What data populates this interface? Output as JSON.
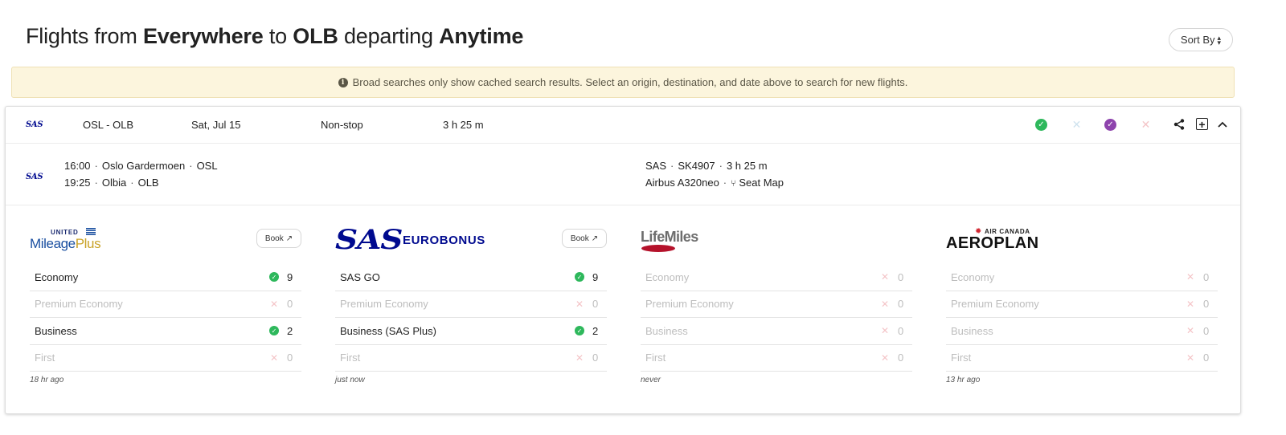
{
  "header": {
    "t1": "Flights from ",
    "origin": "Everywhere",
    "t2": " to ",
    "destination": "OLB",
    "t3": " departing ",
    "when": "Anytime",
    "sort_label": "Sort By"
  },
  "notice": "Broad searches only show cached search results. Select an origin, destination, and date above to search for new flights.",
  "flight": {
    "airline_logo": "SAS",
    "route": "OSL - OLB",
    "date": "Sat, Jul 15",
    "stops": "Non-stop",
    "duration": "3 h 25 m",
    "segment": {
      "dep_time": "16:00",
      "dep_airport": "Oslo Gardermoen",
      "dep_code": "OSL",
      "arr_time": "19:25",
      "arr_airport": "Olbia",
      "arr_code": "OLB",
      "carrier": "SAS",
      "flight_no": "SK4907",
      "duration": "3 h 25 m",
      "aircraft": "Airbus A320neo",
      "seat_map": "Seat Map"
    }
  },
  "status_icons": [
    "check-green",
    "x-blue",
    "check-purple",
    "x-pink"
  ],
  "programs": [
    {
      "logo_top": "UNITED",
      "logo_main_1": "Mileage",
      "logo_main_2": "Plus",
      "book": "Book",
      "updated": "18 hr ago",
      "cabins": [
        {
          "name": "Economy",
          "count": "9",
          "available": true
        },
        {
          "name": "Premium Economy",
          "count": "0",
          "available": false
        },
        {
          "name": "Business",
          "count": "2",
          "available": true
        },
        {
          "name": "First",
          "count": "0",
          "available": false
        }
      ]
    },
    {
      "logo_main_1": "SAS",
      "logo_main_2": "EUROBONUS",
      "book": "Book",
      "updated": "just now",
      "cabins": [
        {
          "name": "SAS GO",
          "count": "9",
          "available": true
        },
        {
          "name": "Premium Economy",
          "count": "0",
          "available": false
        },
        {
          "name": "Business (SAS Plus)",
          "count": "2",
          "available": true
        },
        {
          "name": "First",
          "count": "0",
          "available": false
        }
      ]
    },
    {
      "logo_main_1": "LifeMiles",
      "updated": "never",
      "cabins": [
        {
          "name": "Economy",
          "count": "0",
          "available": false
        },
        {
          "name": "Premium Economy",
          "count": "0",
          "available": false
        },
        {
          "name": "Business",
          "count": "0",
          "available": false
        },
        {
          "name": "First",
          "count": "0",
          "available": false
        }
      ]
    },
    {
      "logo_top": "AIR CANADA",
      "logo_main_1": "AEROPLAN",
      "updated": "13 hr ago",
      "cabins": [
        {
          "name": "Economy",
          "count": "0",
          "available": false
        },
        {
          "name": "Premium Economy",
          "count": "0",
          "available": false
        },
        {
          "name": "Business",
          "count": "0",
          "available": false
        },
        {
          "name": "First",
          "count": "0",
          "available": false
        }
      ]
    }
  ]
}
